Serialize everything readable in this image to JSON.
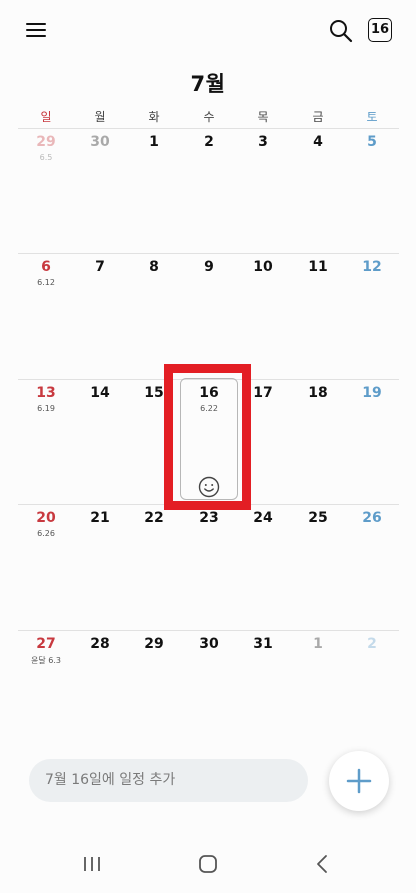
{
  "header": {
    "today_badge": "16",
    "month_title": "7월"
  },
  "weekdays": [
    "일",
    "월",
    "화",
    "수",
    "목",
    "금",
    "토"
  ],
  "weeks": [
    [
      {
        "num": "29",
        "lunar": "6.5",
        "other": true
      },
      {
        "num": "30",
        "other": true
      },
      {
        "num": "1"
      },
      {
        "num": "2"
      },
      {
        "num": "3"
      },
      {
        "num": "4"
      },
      {
        "num": "5"
      }
    ],
    [
      {
        "num": "6",
        "lunar": "6.12"
      },
      {
        "num": "7"
      },
      {
        "num": "8"
      },
      {
        "num": "9"
      },
      {
        "num": "10"
      },
      {
        "num": "11"
      },
      {
        "num": "12"
      }
    ],
    [
      {
        "num": "13",
        "lunar": "6.19"
      },
      {
        "num": "14"
      },
      {
        "num": "15"
      },
      {
        "num": "16",
        "lunar": "6.22",
        "today": true
      },
      {
        "num": "17"
      },
      {
        "num": "18"
      },
      {
        "num": "19"
      }
    ],
    [
      {
        "num": "20",
        "lunar": "6.26"
      },
      {
        "num": "21"
      },
      {
        "num": "22"
      },
      {
        "num": "23"
      },
      {
        "num": "24"
      },
      {
        "num": "25"
      },
      {
        "num": "26"
      }
    ],
    [
      {
        "num": "27",
        "lunar": "윤달 6.3"
      },
      {
        "num": "28"
      },
      {
        "num": "29"
      },
      {
        "num": "30"
      },
      {
        "num": "31"
      },
      {
        "num": "1",
        "other": true
      },
      {
        "num": "2",
        "other": true
      }
    ]
  ],
  "add_event": {
    "placeholder": "7월 16일에 일정 추가"
  },
  "colors": {
    "sunday": "#c8393f",
    "saturday": "#5e9cc9",
    "accent": "#5e9cc9",
    "highlight": "#e31e24"
  }
}
